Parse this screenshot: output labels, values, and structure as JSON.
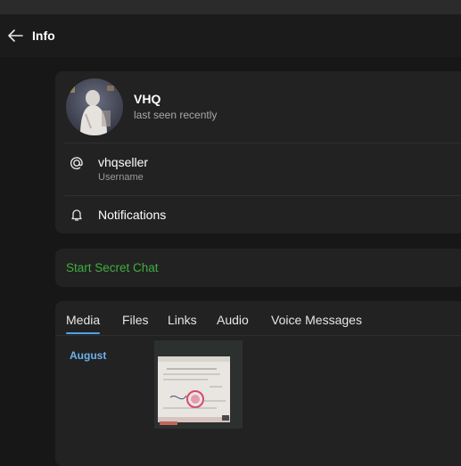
{
  "header": {
    "title": "Info"
  },
  "profile": {
    "name": "VHQ",
    "status": "last seen recently"
  },
  "username": {
    "value": "vhqseller",
    "label": "Username"
  },
  "notifications": {
    "label": "Notifications"
  },
  "secret_chat": {
    "label": "Start Secret Chat"
  },
  "media": {
    "tabs": [
      {
        "label": "Media",
        "active": true
      },
      {
        "label": "Files",
        "active": false
      },
      {
        "label": "Links",
        "active": false
      },
      {
        "label": "Audio",
        "active": false
      },
      {
        "label": "Voice Messages",
        "active": false
      }
    ],
    "month": "August"
  },
  "colors": {
    "accent_blue": "#4ea3e8",
    "secret_green": "#3fae3f"
  }
}
